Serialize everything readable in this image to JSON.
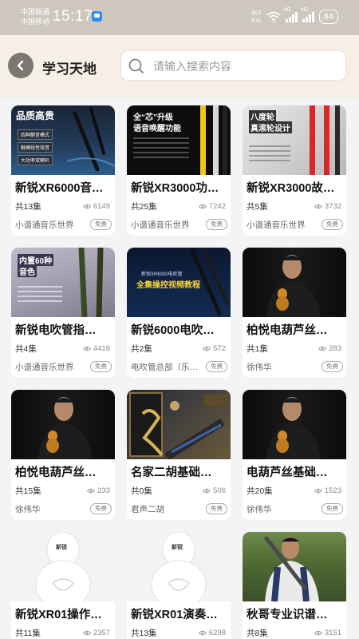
{
  "status_bar": {
    "carrier_1": "中国联通",
    "carrier_2": "中国移动",
    "time": "15:17",
    "net_speed_value": "467",
    "net_speed_unit": "K/s",
    "signal_1_label": "4G",
    "signal_2_label": "4G",
    "battery": "84"
  },
  "header": {
    "title": "学习天地",
    "search_placeholder": "请输入搜索内容"
  },
  "colors": {
    "accent_bg": "#f6efe6",
    "back_button": "#7b7771",
    "badge_border": "#a9a9a9"
  },
  "courses": [
    {
      "title": "新锐XR6000音…",
      "episodes": "共13集",
      "views": "6149",
      "author": "小谱通音乐世界",
      "badge": "免费",
      "thumb_text": [
        "品质高贵",
        "四种颤音模式",
        "触摸线性效音",
        "大功率双喇叭"
      ]
    },
    {
      "title": "新锐XR3000功…",
      "episodes": "共25集",
      "views": "7242",
      "author": "小谱通音乐世界",
      "badge": "免费",
      "thumb_text": [
        "全“芯”升级",
        "语音唤醒功能"
      ]
    },
    {
      "title": "新锐XR3000故…",
      "episodes": "共5集",
      "views": "3732",
      "author": "小谱通音乐世界",
      "badge": "免费",
      "thumb_text": [
        "八度轮",
        "真滚轮设计"
      ]
    },
    {
      "title": "新锐电吹管指…",
      "episodes": "共4集",
      "views": "4416",
      "author": "小谱通音乐世界",
      "badge": "免费",
      "thumb_text": [
        "内置60种",
        "音色"
      ]
    },
    {
      "title": "新锐6000电吹…",
      "episodes": "共2集",
      "views": "572",
      "author": "电吹管总部（乐…",
      "badge": "免费",
      "thumb_text": [
        "新锐XR6000电吹管",
        "全集操控视频教程"
      ]
    },
    {
      "title": "柏悦电葫芦丝…",
      "episodes": "共1集",
      "views": "283",
      "author": "徐伟华",
      "badge": "免费",
      "thumb_text": []
    },
    {
      "title": "柏悦电葫芦丝…",
      "episodes": "共15集",
      "views": "233",
      "author": "徐伟华",
      "badge": "免费",
      "thumb_text": []
    },
    {
      "title": "名家二胡基础…",
      "episodes": "共0集",
      "views": "506",
      "author": "君声二胡",
      "badge": "免费",
      "thumb_text": []
    },
    {
      "title": "电葫芦丝基础…",
      "episodes": "共20集",
      "views": "1523",
      "author": "徐伟华",
      "badge": "免费",
      "thumb_text": []
    },
    {
      "title": "新锐XR01操作…",
      "episodes": "共11集",
      "views": "2357",
      "author": "",
      "badge": "",
      "thumb_text": [
        "新锐"
      ]
    },
    {
      "title": "新锐XR01演奏…",
      "episodes": "共13集",
      "views": "6298",
      "author": "",
      "badge": "",
      "thumb_text": [
        "新锐"
      ]
    },
    {
      "title": "秋哥专业识谱…",
      "episodes": "共8集",
      "views": "3151",
      "author": "",
      "badge": "",
      "thumb_text": []
    }
  ]
}
